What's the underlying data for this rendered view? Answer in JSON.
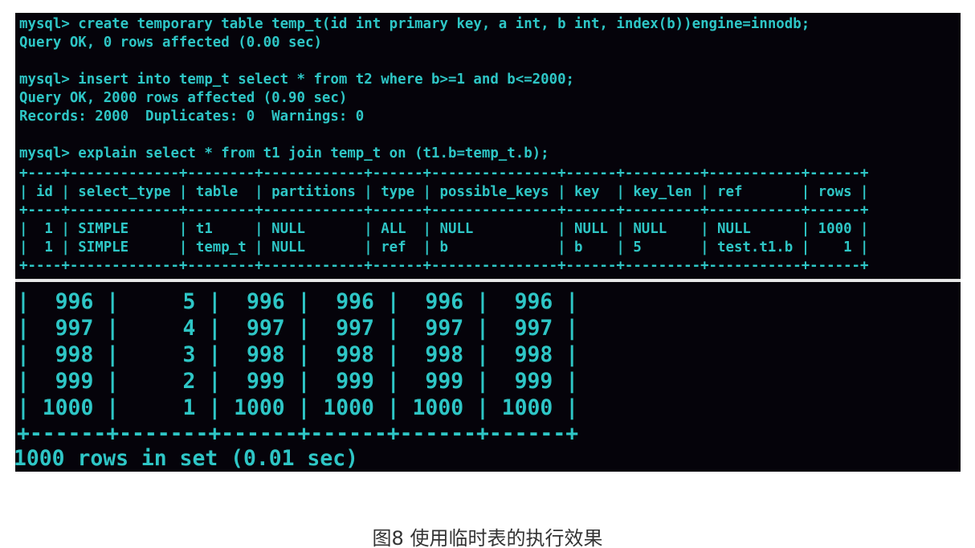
{
  "terminal_top": {
    "lines": [
      "mysql> create temporary table temp_t(id int primary key, a int, b int, index(b))engine=innodb;",
      "Query OK, 0 rows affected (0.00 sec)",
      "",
      "mysql> insert into temp_t select * from t2 where b>=1 and b<=2000;",
      "Query OK, 2000 rows affected (0.90 sec)",
      "Records: 2000  Duplicates: 0  Warnings: 0",
      "",
      "mysql> explain select * from t1 join temp_t on (t1.b=temp_t.b);",
      "+----+-------------+--------+------------+------+---------------+------+---------+-----------+------+",
      "| id | select_type | table  | partitions | type | possible_keys | key  | key_len | ref       | rows |",
      "+----+-------------+--------+------------+------+---------------+------+---------+-----------+------+",
      "|  1 | SIMPLE      | t1     | NULL       | ALL  | NULL          | NULL | NULL    | NULL      | 1000 |",
      "|  1 | SIMPLE      | temp_t | NULL       | ref  | b             | b    | 5       | test.t1.b |    1 |",
      "+----+-------------+--------+------------+------+---------------+------+---------+-----------+------+"
    ]
  },
  "terminal_bottom": {
    "lines": [
      "|  996 |     5 |  996 |  996 |  996 |  996 |",
      "|  997 |     4 |  997 |  997 |  997 |  997 |",
      "|  998 |     3 |  998 |  998 |  998 |  998 |",
      "|  999 |     2 |  999 |  999 |  999 |  999 |",
      "| 1000 |     1 | 1000 | 1000 | 1000 | 1000 |",
      "",
      "+------+-------+------+------+------+------+",
      "1000 rows in set (0.01 sec)"
    ]
  },
  "caption": "图8 使用临时表的执行效果"
}
